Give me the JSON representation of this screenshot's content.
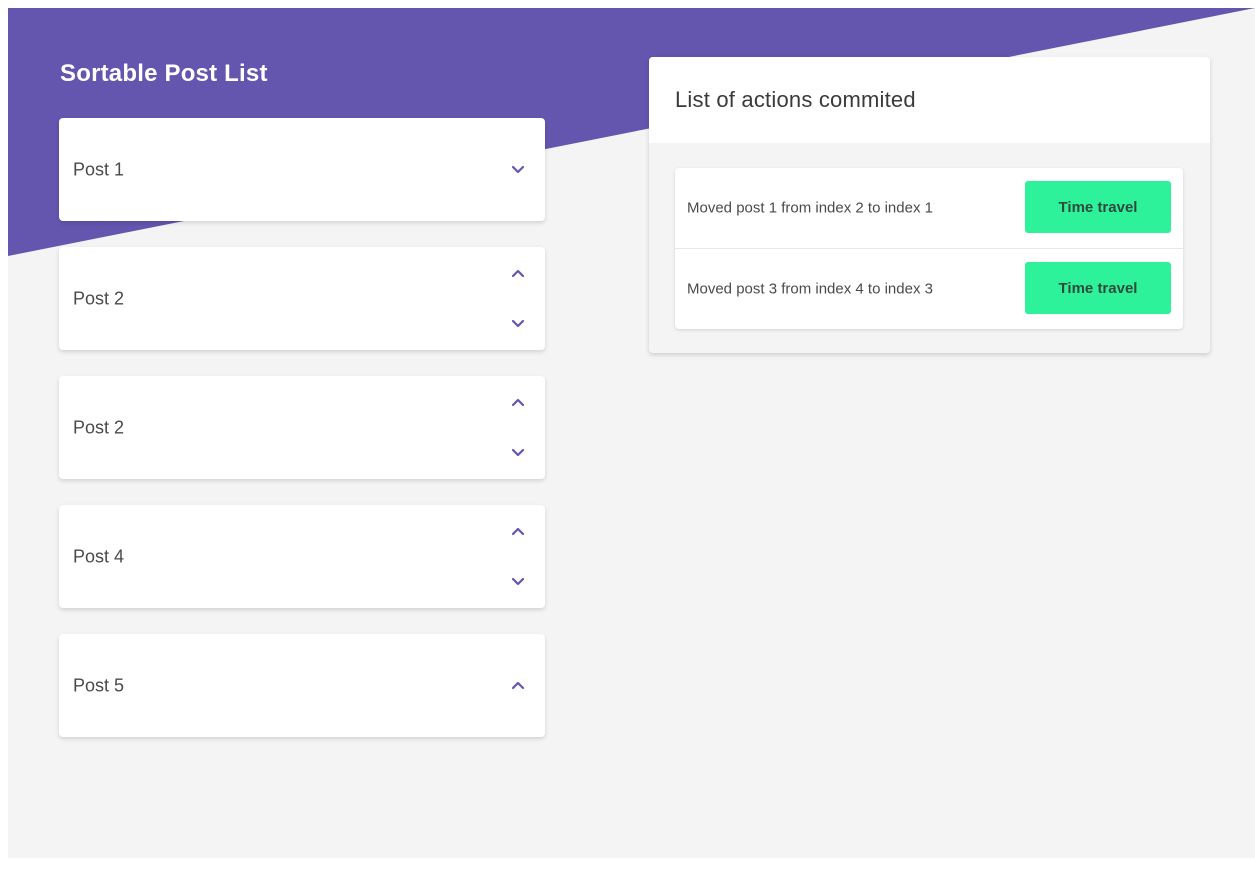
{
  "app": {
    "title": "Sortable Post List"
  },
  "colors": {
    "brand": "#6456af",
    "accent_button": "#2ef29a",
    "background": "#f4f4f4",
    "arrow": "#6456af"
  },
  "posts": [
    {
      "title": "Post 1",
      "controls": [
        "chevron-down-icon"
      ]
    },
    {
      "title": "Post 2",
      "controls": [
        "chevron-up-icon",
        "chevron-down-icon"
      ]
    },
    {
      "title": "Post 2",
      "controls": [
        "chevron-up-icon",
        "chevron-down-icon"
      ]
    },
    {
      "title": "Post 4",
      "controls": [
        "chevron-up-icon",
        "chevron-down-icon"
      ]
    },
    {
      "title": "Post 5",
      "controls": [
        "chevron-up-icon"
      ]
    }
  ],
  "actions_panel": {
    "title": "List of actions commited",
    "items": [
      {
        "text": "Moved post 1 from index 2 to index 1",
        "button_label": "Time travel"
      },
      {
        "text": "Moved post 3 from index 4 to index 3",
        "button_label": "Time travel"
      }
    ]
  }
}
